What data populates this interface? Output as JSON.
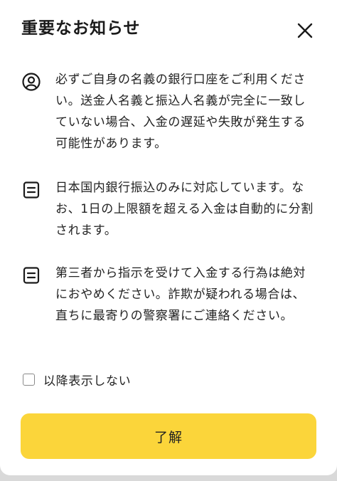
{
  "dialog": {
    "title": "重要なお知らせ",
    "close_icon": "close-icon"
  },
  "notices": [
    {
      "icon": "user-circle-icon",
      "text": "必ずご自身の名義の銀行口座をご利用ください。送金人名義と振込人名義が完全に一致していない場合、入金の遅延や失敗が発生する可能性があります。"
    },
    {
      "icon": "document-icon",
      "text": "日本国内銀行振込のみに対応しています。なお、1日の上限額を超える入金は自動的に分割されます。"
    },
    {
      "icon": "document-icon",
      "text": "第三者から指示を受けて入金する行為は絶対におやめください。詐欺が疑われる場合は、直ちに最寄りの警察署にご連絡ください。"
    }
  ],
  "checkbox": {
    "label": "以降表示しない",
    "checked": false
  },
  "confirm_button": {
    "label": "了解",
    "color": "#fbd53a"
  }
}
